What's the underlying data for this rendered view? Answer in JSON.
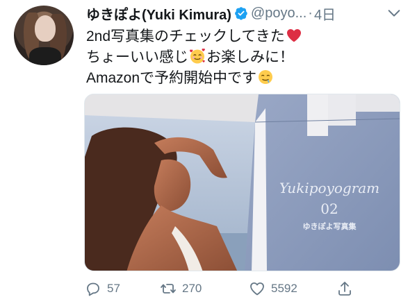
{
  "tweet": {
    "display_name": "ゆきぽよ(Yuki Kimura)",
    "handle": "@poyo...",
    "separator": "·",
    "time": "4日",
    "lines": [
      "2nd写真集のチェックしてきた",
      "ちょーいい感じ",
      "お楽しみに！",
      "Amazonで予約開始中です"
    ],
    "media": {
      "book_title": "Yukipoyogram",
      "book_number": "02",
      "book_subtitle": "ゆきぽよ写真集"
    },
    "actions": {
      "reply_count": "57",
      "retweet_count": "270",
      "like_count": "5592"
    }
  },
  "icons": {
    "verified": "verified-badge-icon",
    "caret": "chevron-down-icon",
    "reply": "reply-icon",
    "retweet": "retweet-icon",
    "like": "heart-icon",
    "share": "share-icon",
    "emoji_heart": "red-heart-emoji",
    "emoji_hearts_face": "smiling-face-with-hearts-emoji",
    "emoji_drool": "drooling-face-emoji"
  },
  "colors": {
    "text": "#14171a",
    "secondary": "#657786",
    "verified": "#1da1f2",
    "heart": "#e0245e"
  }
}
